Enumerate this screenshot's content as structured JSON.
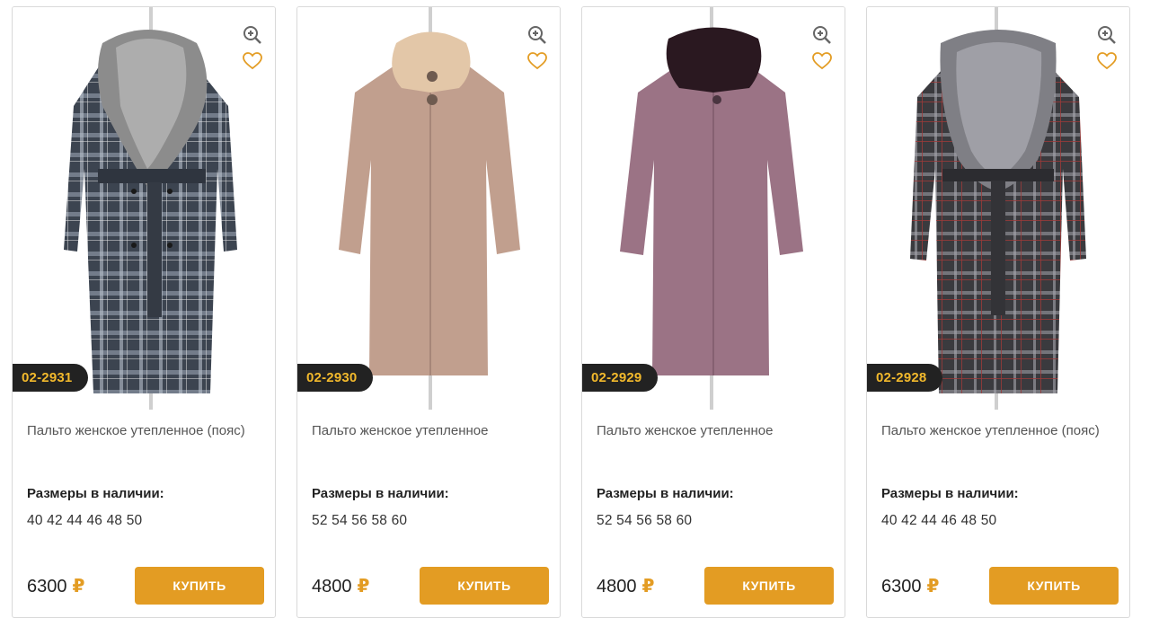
{
  "currency_symbol": "₽",
  "buy_label": "КУПИТЬ",
  "sizes_label": "Размеры в наличии:",
  "colors": {
    "accent": "#e39c23",
    "article_bg": "#222222",
    "article_text": "#f2b92c"
  },
  "products": [
    {
      "article": "02-2931",
      "name": "Пальто женское утепленное (пояс)",
      "sizes": "40 42 44 46 48 50",
      "price": "6300",
      "coat": "gray-plaid",
      "collar": "silver-fur"
    },
    {
      "article": "02-2930",
      "name": "Пальто женское утепленное",
      "sizes": "52 54 56 58 60",
      "price": "4800",
      "coat": "beige",
      "collar": "beige-fur"
    },
    {
      "article": "02-2929",
      "name": "Пальто женское утепленное",
      "sizes": "52 54 56 58 60",
      "price": "4800",
      "coat": "mauve",
      "collar": "dark-fur"
    },
    {
      "article": "02-2928",
      "name": "Пальто женское утепленное (пояс)",
      "sizes": "40 42 44 46 48 50",
      "price": "6300",
      "coat": "dark-plaid",
      "collar": "silver-fur"
    }
  ]
}
